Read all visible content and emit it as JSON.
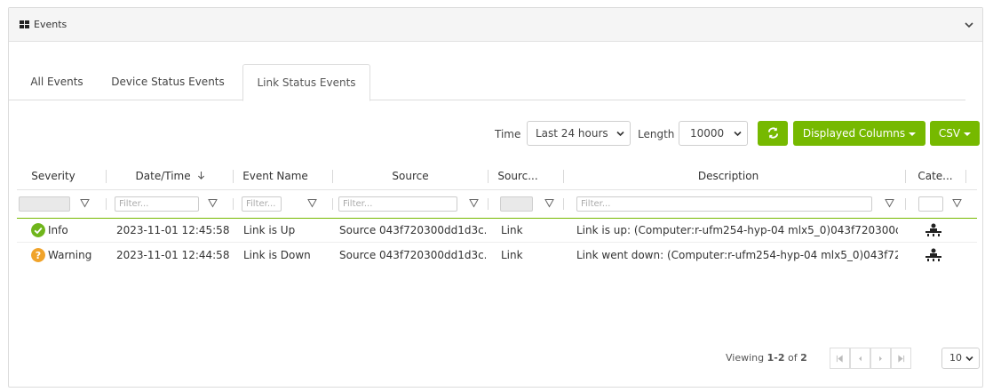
{
  "panel": {
    "title": "Events"
  },
  "tabs": [
    {
      "label": "All Events"
    },
    {
      "label": "Device Status Events"
    },
    {
      "label": "Link Status Events"
    }
  ],
  "toolbar": {
    "time_label": "Time",
    "time_value": "Last 24 hours",
    "length_label": "Length",
    "length_value": "10000",
    "displayed_columns_label": "Displayed Columns",
    "csv_label": "CSV"
  },
  "table": {
    "columns": [
      "Severity",
      "Date/Time",
      "Event Name",
      "Source",
      "Sourc...",
      "Description",
      "Cate..."
    ],
    "filter_placeholder": "Filter...",
    "rows": [
      {
        "severity": "Info",
        "severity_icon": "check-circle-icon",
        "datetime": "2023-11-01 12:45:58",
        "event_name": "Link is Up",
        "source": "Source 043f720300dd1d3c...",
        "source_type": "Link",
        "description": "Link is up: (Computer:r-ufm254-hyp-04 mlx5_0)043f720300dd...",
        "category_icon": "hardware-icon"
      },
      {
        "severity": "Warning",
        "severity_icon": "question-circle-icon",
        "datetime": "2023-11-01 12:44:58",
        "event_name": "Link is Down",
        "source": "Source 043f720300dd1d3c...",
        "source_type": "Link",
        "description": "Link went down: (Computer:r-ufm254-hyp-04 mlx5_0)043f720...",
        "category_icon": "hardware-icon"
      }
    ]
  },
  "pager": {
    "viewing_prefix": "Viewing",
    "range": "1-2",
    "of_text": "of",
    "total": "2",
    "page_size": "10"
  },
  "colors": {
    "accent": "#76b900",
    "info": "#6fb51b",
    "warning": "#f0a32a"
  }
}
